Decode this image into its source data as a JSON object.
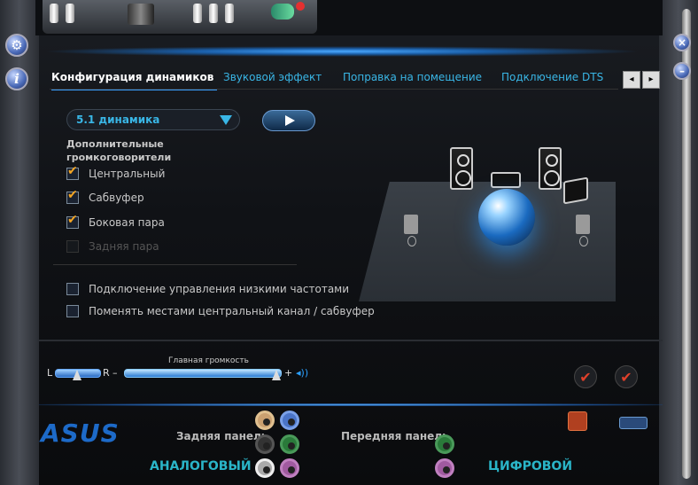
{
  "tabs": [
    {
      "label": "Конфигурация динамиков",
      "active": true
    },
    {
      "label": "Звуковой эффект",
      "active": false
    },
    {
      "label": "Поправка на помещение",
      "active": false
    },
    {
      "label": "Подключение DTS",
      "active": false
    }
  ],
  "tab_scroll": {
    "prev": "◂",
    "next": "▸"
  },
  "speaker_select": {
    "value": "5.1 динамика"
  },
  "extra_speakers_label": "Дополнительные громкоговорители",
  "checkboxes": [
    {
      "label": "Центральный",
      "checked": true,
      "enabled": true
    },
    {
      "label": "Сабвуфер",
      "checked": true,
      "enabled": true
    },
    {
      "label": "Боковая пара",
      "checked": true,
      "enabled": true
    },
    {
      "label": "Задняя пара",
      "checked": false,
      "enabled": false
    }
  ],
  "options": [
    {
      "label": "Подключение управления низкими частотами",
      "checked": false
    },
    {
      "label": "Поменять местами центральный канал / сабвуфер",
      "checked": false
    }
  ],
  "volume": {
    "title": "Главная громкость",
    "left_label": "L",
    "right_label": "R",
    "minus": "–",
    "plus": "+",
    "level": 0.98,
    "balance": 0.5
  },
  "bottom": {
    "logo": "ASUS",
    "rear_panel": "Задняя панель",
    "front_panel": "Передняя панель",
    "analog": "АНАЛОГОВЫЙ",
    "digital": "ЦИФРОВОЙ"
  },
  "colors": {
    "accent": "#39b6e6",
    "check": "#f5a623",
    "logo": "#1d6ac8"
  }
}
